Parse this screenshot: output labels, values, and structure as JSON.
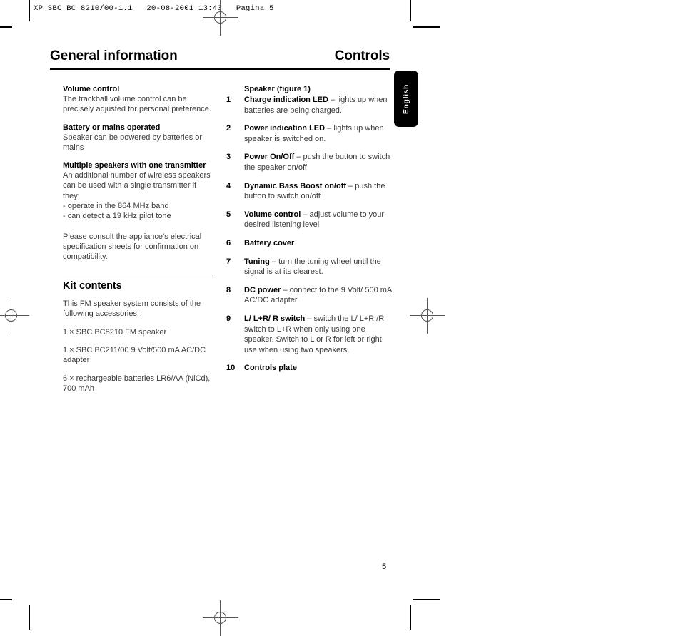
{
  "print_header": "XP SBC BC 8210/00-1.1   20-08-2001 13:43   Pagina 5",
  "page_number": "5",
  "language_tab": "English",
  "header": {
    "title_left": "General information",
    "title_right": "Controls"
  },
  "left_column": {
    "blocks": [
      {
        "heading": "Volume control",
        "body": "The trackball volume control can be precisely adjusted for personal preference."
      },
      {
        "heading": "Battery or mains operated",
        "body": "Speaker can be powered by batteries or mains"
      },
      {
        "heading": "Multiple speakers with one transmitter",
        "body": "An additional number of wireless speakers can be used with a single transmitter if they:",
        "bullets": [
          "- operate in the 864 MHz band",
          "- can detect a 19 kHz pilot tone"
        ],
        "body2": "Please consult the appliance’s electrical specification sheets for confirmation on compatibility."
      }
    ],
    "section": {
      "heading": "Kit contents",
      "intro": "This FM speaker system consists of the following accessories:",
      "items": [
        "1 × SBC BC8210 FM speaker",
        "1 × SBC BC211/00 9 Volt/500 mA AC/DC adapter",
        "6 × rechargeable batteries LR6/AA (NiCd), 700 mAh"
      ]
    }
  },
  "right_column": {
    "heading": "Speaker (figure 1)",
    "items": [
      {
        "num": "1",
        "label": "Charge indication LED",
        "dash": " – ",
        "desc": "lights up when batteries are being charged."
      },
      {
        "num": "2",
        "label": "Power indication LED",
        "dash": " – ",
        "desc": "lights up when speaker is switched on."
      },
      {
        "num": "3",
        "label": "Power On/Off",
        "dash": " – ",
        "desc": "push the button to switch the speaker on/off."
      },
      {
        "num": "4",
        "label": "Dynamic Bass Boost on/off",
        "dash": " – ",
        "desc": "push the button to switch on/off"
      },
      {
        "num": "5",
        "label": "Volume control",
        "dash": " – ",
        "desc": "adjust volume to your desired listening level"
      },
      {
        "num": "6",
        "label": "Battery cover",
        "dash": "",
        "desc": ""
      },
      {
        "num": "7",
        "label": "Tuning",
        "dash": " – ",
        "desc": "turn the tuning wheel until the signal is at its clearest."
      },
      {
        "num": "8",
        "label": "DC power",
        "dash": " – ",
        "desc": "connect to the 9 Volt/ 500 mA AC/DC adapter"
      },
      {
        "num": "9",
        "label": "L/ L+R/ R switch",
        "dash": " – ",
        "desc": "switch the L/ L+R /R switch to L+R when only using one speaker. Switch to L or R for left or right use when using two speakers."
      },
      {
        "num": "10",
        "label": "Controls plate",
        "dash": "",
        "desc": ""
      }
    ]
  },
  "colors": {
    "ink": "#000000",
    "body_gray": "#3a3a3a",
    "tab_background": "#000000",
    "tab_text": "#ffffff",
    "mark_gray": "#555555"
  }
}
